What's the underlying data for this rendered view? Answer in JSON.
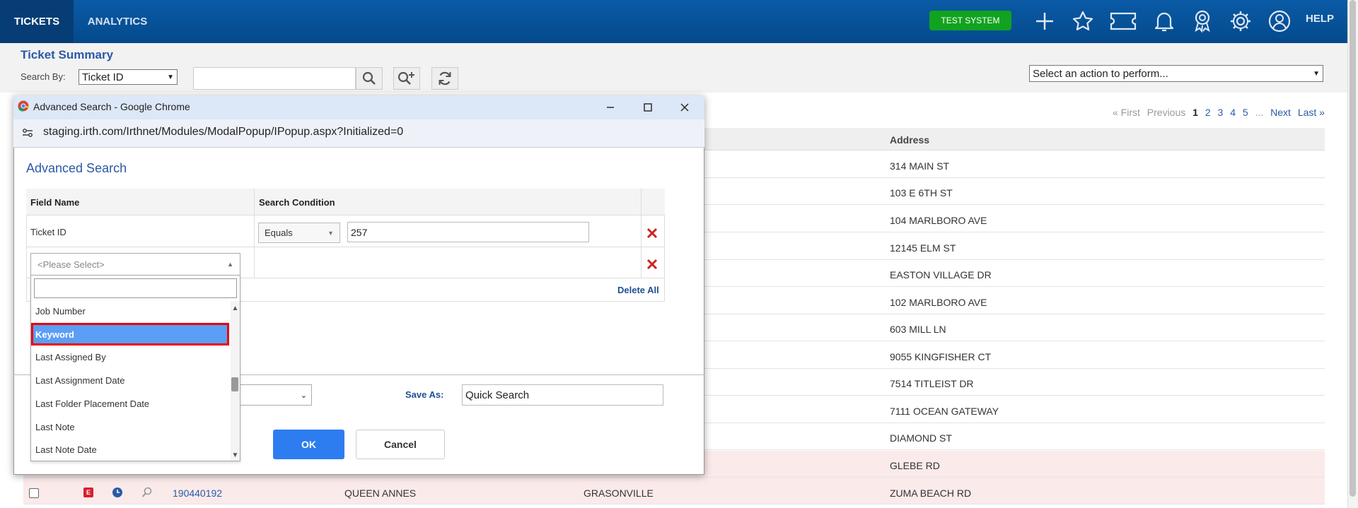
{
  "nav": {
    "tabs": [
      "TICKETS",
      "ANALYTICS"
    ],
    "badge": "TEST SYSTEM",
    "help": "HELP",
    "icons": [
      "plus-icon",
      "star-icon",
      "ticket-icon",
      "bell-icon",
      "award-icon",
      "gear-icon",
      "user-icon"
    ]
  },
  "header": {
    "title": "Ticket Summary",
    "search_by_label": "Search By:",
    "search_by_value": "Ticket ID",
    "action_select": "Select an action to perform..."
  },
  "pager": {
    "first": "« First",
    "previous": "Previous",
    "pages": [
      "1",
      "2",
      "3",
      "4",
      "5",
      "..."
    ],
    "next": "Next",
    "last": "Last »"
  },
  "table": {
    "address_header": "Address",
    "addresses": [
      "314 MAIN ST",
      "103 E 6TH ST",
      "104 MARLBORO AVE",
      "12145 ELM ST",
      "EASTON VILLAGE DR",
      "102 MARLBORO AVE",
      "603 MILL LN",
      "9055 KINGFISHER CT",
      "7514 TITLEIST DR",
      "7111 OCEAN GATEWAY",
      "DIAMOND ST",
      "GLEBE RD",
      "ZUMA BEACH RD"
    ],
    "last_row": {
      "badge": "E",
      "ticket": "190440192",
      "county": "QUEEN ANNES",
      "city": "GRASONVILLE"
    }
  },
  "modal": {
    "window_title": "Advanced Search - Google Chrome",
    "url": "staging.irth.com/Irthnet/Modules/ModalPopup/IPopup.aspx?Initialized=0",
    "heading": "Advanced Search",
    "col_field": "Field Name",
    "col_condition": "Search Condition",
    "row1": {
      "field": "Ticket ID",
      "condition": "Equals",
      "value": "257"
    },
    "row2_placeholder": "<Please Select>",
    "delete_all": "Delete All",
    "save_as_label": "Save As:",
    "save_as_value": "Quick Search",
    "ok": "OK",
    "cancel": "Cancel"
  },
  "dropdown": {
    "items": [
      "Job Number",
      "Keyword",
      "Last Assigned By",
      "Last Assignment Date",
      "Last Folder Placement Date",
      "Last Note",
      "Last Note Date"
    ],
    "highlighted": "Keyword"
  },
  "colors": {
    "nav_bg": "#0a5aa6",
    "accent": "#2a5aa6",
    "badge_green": "#11a31f",
    "ok_blue": "#2d7df0",
    "highlight": "#5a9ef5",
    "highlight_border": "#e00000",
    "delete_red": "#d02020"
  }
}
